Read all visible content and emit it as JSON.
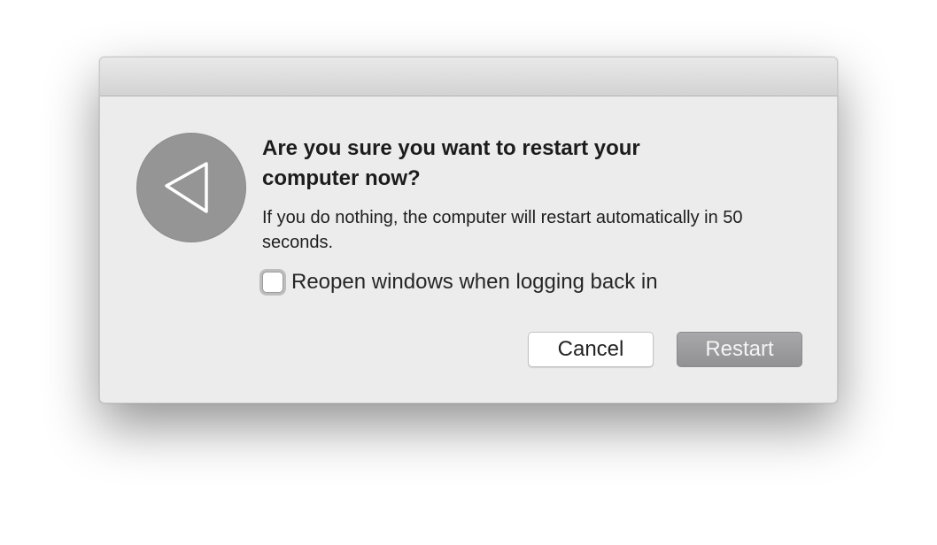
{
  "dialog": {
    "heading": "Are you sure you want to restart your computer now?",
    "message": "If you do nothing, the computer will restart automatically in 50 seconds.",
    "icon": "restart-triangle-icon",
    "checkbox": {
      "label": "Reopen windows when logging back in",
      "checked": false
    },
    "buttons": {
      "cancel_label": "Cancel",
      "restart_label": "Restart"
    }
  },
  "colors": {
    "dialog_background": "#ececec",
    "icon_circle": "#959595",
    "default_button": "#9d9da0"
  }
}
